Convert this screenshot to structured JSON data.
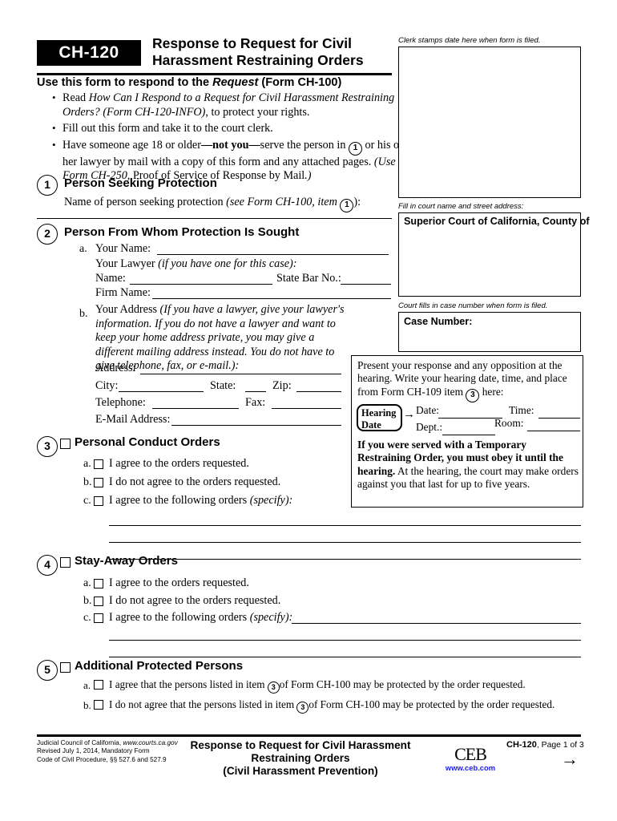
{
  "header": {
    "form_number": "CH-120",
    "title_line1": "Response to Request for Civil",
    "title_line2": "Harassment Restraining Orders",
    "instruction_heading_a": "Use this form to respond to the ",
    "instruction_heading_italic": "Request",
    "instruction_heading_b": " (Form CH-100)",
    "bullets": [
      {
        "pre": "Read ",
        "italic": "How Can I Respond to a Request for Civil Harassment Restraining Orders? (Form CH-120-INFO)",
        "post": ", to protect your rights."
      },
      {
        "pre": "Fill out this form and take it to the court clerk.",
        "italic": "",
        "post": ""
      },
      {
        "pre": "Have someone age 18 or older",
        "bold": "—not you—",
        "post": "serve the person in ",
        "circle": "1",
        "post2": " or his or her lawyer by mail with a copy of this form and any attached pages. ",
        "italic2": "(Use Form CH-250,",
        "post3": " Proof of Service of Response by Mail",
        "italic3": ".)"
      }
    ]
  },
  "right_column": {
    "clerk_stamp_caption": "Clerk stamps date here when form is filed.",
    "court_caption": "Fill in court name and street address:",
    "court_box_title": "Superior Court of California, County of",
    "case_caption": "Court fills in case number when form is filed.",
    "case_box_title": "Case Number:"
  },
  "hearing_panel": {
    "intro_a": "Present your response and any opposition at the hearing. Write your hearing date, time, and place from Form CH-109 item ",
    "intro_circle": "3",
    "intro_b": " here:",
    "pill_line1": "Hearing",
    "pill_line2": "Date",
    "arrow": "→",
    "label_date": "Date:",
    "label_time": "Time:",
    "label_dept": "Dept.:",
    "label_room": "Room:",
    "warn_bold": "If you were served with a Temporary Restraining Order, you must obey it until the hearing.",
    "warn_rest": " At the hearing, the court may make orders against you that last for up to five years."
  },
  "sections": {
    "s1": {
      "number": "1",
      "title": "Person Seeking Protection",
      "line_a": "Name of person seeking protection ",
      "line_italic": "(see Form CH-100, item ",
      "line_circle": "1",
      "line_b": "):"
    },
    "s2": {
      "number": "2",
      "title": "Person From Whom Protection Is Sought",
      "a_letter": "a.",
      "a_label": "Your Name:",
      "lawyer_label": "Your Lawyer ",
      "lawyer_italic": "(if you have one for this case):",
      "name_label": "Name:",
      "bar_label": "State Bar No.:",
      "firm_label": "Firm Name:",
      "b_letter": "b.",
      "b_label": "Your Address ",
      "b_italic": "(If you have a lawyer, give your lawyer's information. If you do not have a lawyer and want to keep your home address private, you may give a different mailing address instead. You do not have to give telephone, fax, or e-mail.):",
      "address_label": "Address:",
      "city_label": "City:",
      "state_label": "State:",
      "zip_label": "Zip:",
      "telephone_label": "Telephone:",
      "fax_label": "Fax:",
      "email_label": "E-Mail Address:"
    },
    "s3": {
      "number": "3",
      "title": "Personal Conduct Orders",
      "items": [
        {
          "letter": "a.",
          "text": "I agree to the orders requested.",
          "italic": ""
        },
        {
          "letter": "b.",
          "text": "I do not agree to the orders requested.",
          "italic": ""
        },
        {
          "letter": "c.",
          "text": "I agree to the following orders ",
          "italic": "(specify):"
        }
      ]
    },
    "s4": {
      "number": "4",
      "title": "Stay-Away Orders",
      "items": [
        {
          "letter": "a.",
          "text": "I agree to the orders requested.",
          "italic": ""
        },
        {
          "letter": "b.",
          "text": "I do not agree to the orders requested.",
          "italic": ""
        },
        {
          "letter": "c.",
          "text": "I agree to the following orders ",
          "italic": "(specify):"
        }
      ]
    },
    "s5": {
      "number": "5",
      "title": "Additional Protected Persons",
      "items": [
        {
          "letter": "a.",
          "pre": "I agree that the persons listed in item ",
          "circle": "3",
          "post": "of Form CH-100 may be protected by the order requested."
        },
        {
          "letter": "b.",
          "pre": "I do not agree that the persons listed in item ",
          "circle": "3",
          "post": "of Form CH-100 may be protected by the order requested."
        }
      ]
    }
  },
  "footer": {
    "left_line1_a": "Judicial Council of California, ",
    "left_line1_italic": "www.courts.ca.gov",
    "left_line2": "Revised July 1, 2014, Mandatory Form",
    "left_line3": "Code of Civil Procedure, §§ 527.6 and 527.9",
    "center_line1": "Response to Request for Civil Harassment",
    "center_line2": "Restraining Orders",
    "center_line3": "(Civil Harassment Prevention)",
    "ceb_mark": "CEB",
    "ceb_url": "www.ceb.com",
    "ceb_url_color": "#1a1af0",
    "page_form": "CH-120",
    "page_text": ", Page 1 of 3",
    "next_arrow": "→"
  }
}
